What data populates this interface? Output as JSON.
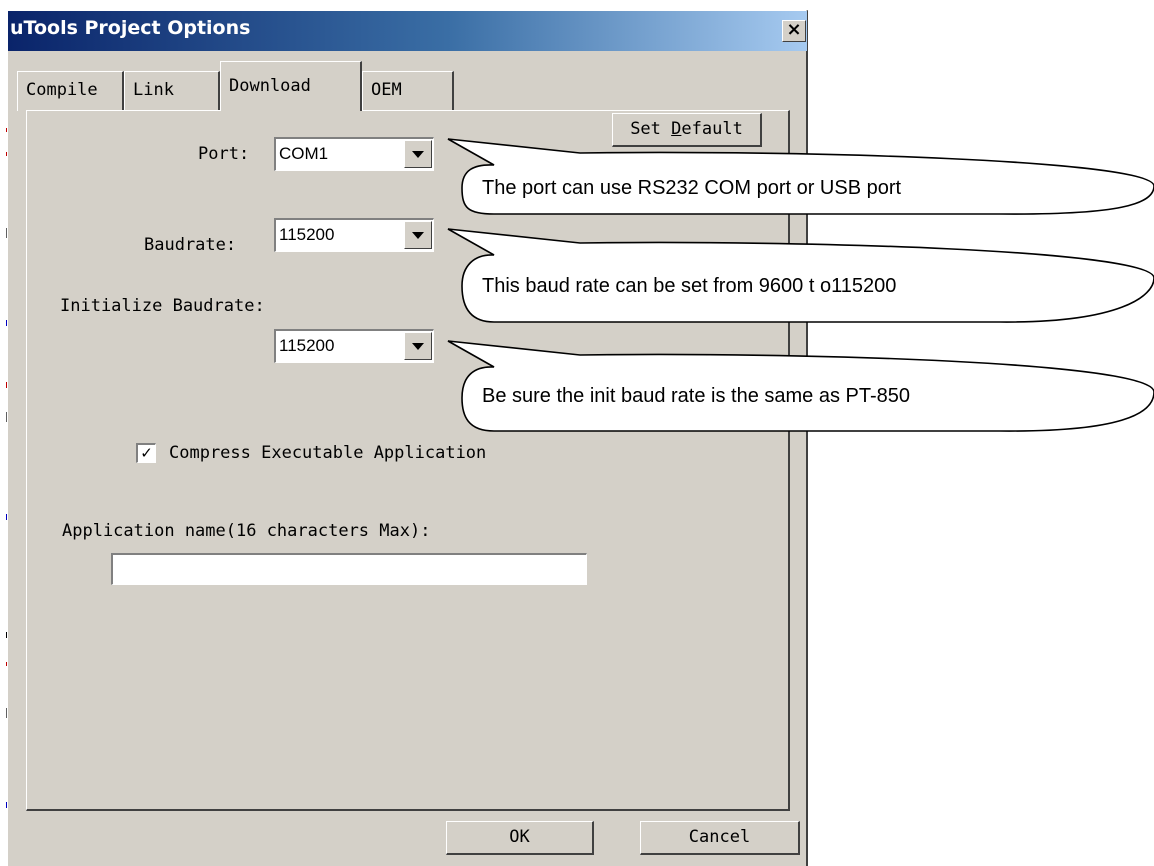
{
  "window": {
    "title": "uTools Project Options",
    "close_glyph": "×"
  },
  "tabs": [
    {
      "label": "Compile",
      "active": false
    },
    {
      "label": "Link",
      "active": false
    },
    {
      "label": "Download",
      "active": true
    },
    {
      "label": "OEM",
      "active": false
    }
  ],
  "download": {
    "set_default_prefix": "Set ",
    "set_default_mnemonic": "D",
    "set_default_suffix": "efault",
    "port_label": "Port:",
    "port_value": "COM1",
    "baudrate_label": "Baudrate:",
    "baudrate_value": "115200",
    "init_baudrate_label": "Initialize Baudrate:",
    "init_baudrate_value": "115200",
    "compress_label": "Compress Executable Application",
    "compress_checked": true,
    "compress_check_glyph": "✓",
    "appname_label": "Application name(16 characters Max):",
    "appname_value": ""
  },
  "buttons": {
    "ok": "OK",
    "cancel": "Cancel"
  },
  "callouts": [
    {
      "text": "The port can use RS232 COM port or USB port"
    },
    {
      "text": "This baud rate can be set from 9600 t o115200"
    },
    {
      "text": "Be sure the init baud rate is the same as PT-850"
    }
  ],
  "icons": {
    "close": "close-icon",
    "dropdown": "chevron-down-icon",
    "check": "checkmark-icon"
  },
  "colors": {
    "dialog_bg": "#d4d0c8",
    "title_gradient_start": "#0a246a",
    "title_gradient_end": "#a6caf0"
  }
}
